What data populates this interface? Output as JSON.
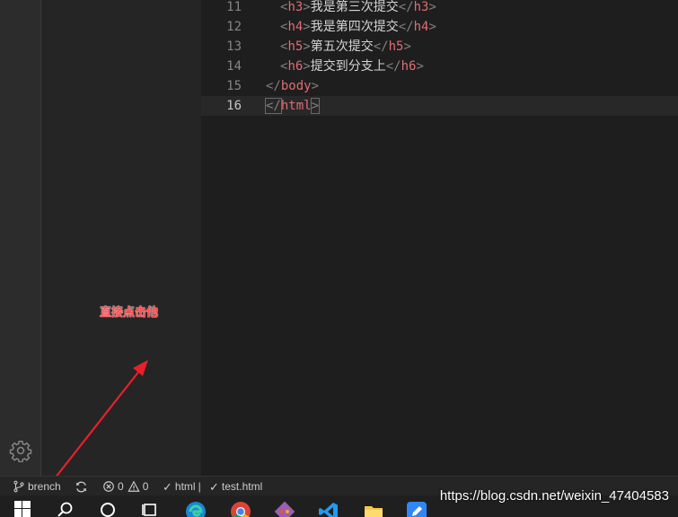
{
  "editor": {
    "lines": [
      {
        "num": "11",
        "open": "h3",
        "text": "我是第三次提交",
        "close": "h3",
        "indent": true
      },
      {
        "num": "12",
        "open": "h4",
        "text": "我是第四次提交",
        "close": "h4",
        "indent": true
      },
      {
        "num": "13",
        "open": "h5",
        "text": "第五次提交",
        "close": "h5",
        "indent": true
      },
      {
        "num": "14",
        "open": "h6",
        "text": "提交到分支上",
        "close": "h6",
        "indent": true
      },
      {
        "num": "15",
        "close": "body",
        "indent": false
      },
      {
        "num": "16",
        "close": "html",
        "indent": false
      }
    ]
  },
  "annotation": {
    "text": "直接点击他",
    "color": "#ff4b4b"
  },
  "status_bar": {
    "branch": "brench",
    "errors": "0",
    "warnings": "0",
    "language": "html",
    "separator": "|",
    "file": "test.html"
  },
  "taskbar": {
    "icons": [
      "windows-start-icon",
      "search-icon",
      "cortana-icon",
      "task-view-icon",
      "edge-icon",
      "chrome-icon",
      "git-icon",
      "vscode-icon",
      "file-explorer-icon",
      "editor-app-icon"
    ]
  },
  "watermark": "https://blog.csdn.net/weixin_47404583"
}
